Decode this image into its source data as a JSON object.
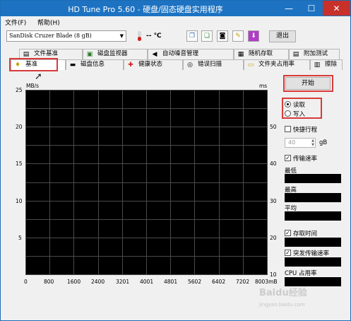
{
  "window": {
    "title": "HD Tune Pro 5.60 - 硬盘/固态硬盘实用程序",
    "min": "—",
    "max": "☐",
    "close": "✕"
  },
  "menu": [
    "文件(F)",
    "帮助(H)"
  ],
  "toolbar": {
    "drive": "SanDisk Cruzer Blade (8 gB)",
    "temperature": "-- ℃",
    "exit_label": "退出",
    "buttons": [
      "copy-icon",
      "paste-icon",
      "camera-icon",
      "tools-icon",
      "download-icon"
    ]
  },
  "tabs_top": [
    "文件基准",
    "磁盘监视器",
    "自动噪音管理",
    "随机存取",
    "附加测试"
  ],
  "tabs_bottom": [
    "基准",
    "磁盘信息",
    "健康状态",
    "错误扫描",
    "文件夹占用率",
    "擦除"
  ],
  "chart": {
    "left_unit": "MB/s",
    "right_unit": "ms",
    "left_ticks": [
      "25",
      "20",
      "15",
      "10",
      "5"
    ],
    "right_ticks": [
      "50",
      "40",
      "30",
      "20",
      "10"
    ],
    "x_ticks": [
      "0",
      "800",
      "1600",
      "2400",
      "3201",
      "4001",
      "4801",
      "5602",
      "6402",
      "7202",
      "8003mB"
    ]
  },
  "chart_data": {
    "type": "line",
    "title": "",
    "xlabel": "",
    "ylabel": "MB/s",
    "y2label": "ms",
    "xlim": [
      0,
      8003
    ],
    "ylim": [
      0,
      25
    ],
    "y2lim": [
      0,
      50
    ],
    "x_ticks": [
      0,
      800,
      1600,
      2400,
      3201,
      4001,
      4801,
      5602,
      6402,
      7202,
      8003
    ],
    "x_unit": "mB",
    "y_ticks": [
      5,
      10,
      15,
      20,
      25
    ],
    "y2_ticks": [
      10,
      20,
      30,
      40,
      50
    ],
    "grid": true,
    "series": []
  },
  "panel": {
    "start": "开始",
    "read": "读取",
    "write": "写入",
    "quick_test": "快捷行程",
    "quick_value": "40",
    "quick_unit": "gB",
    "transfer_rate": "传输速率",
    "min": "最低",
    "max": "最高",
    "avg": "平均",
    "access_time": "存取时间",
    "burst_rate": "突发传输速率",
    "cpu": "CPU 占用率"
  },
  "watermark": {
    "text": "Baidu经验",
    "sub": "jingyan.baidu.com"
  },
  "colors": {
    "titlebar": "#1d73c2",
    "close": "#c7312a",
    "highlight": "#d93a3a",
    "chart_bg": "#000000",
    "grid": "#4a4a4a"
  }
}
